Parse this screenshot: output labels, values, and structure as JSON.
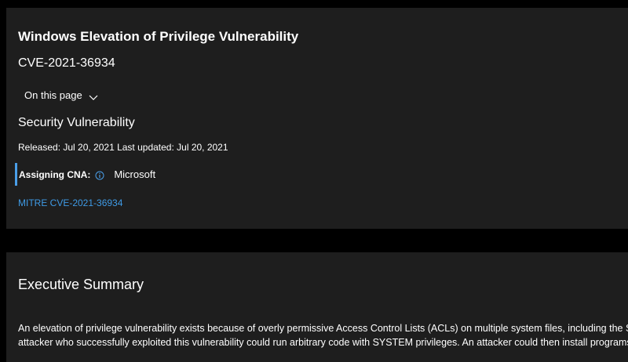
{
  "header": {
    "title": "Windows Elevation of Privilege Vulnerability",
    "cve_id": "CVE-2021-36934",
    "on_this_page": "On this page",
    "section_heading": "Security Vulnerability",
    "released": "Released: Jul 20, 2021 Last updated: Jul 20, 2021",
    "cna_label": "Assigning CNA:",
    "cna_value": "Microsoft",
    "mitre_link": "MITRE CVE-2021-36934"
  },
  "summary": {
    "heading": "Executive Summary",
    "line1": "An elevation of privilege vulnerability exists because of overly permissive Access Control Lists (ACLs) on multiple system files, including the Sec",
    "line2": "attacker who successfully exploited this vulnerability could run arbitrary code with SYSTEM privileges. An attacker could then install programs;"
  },
  "icons": {
    "chevron": "chevron-down-icon",
    "info": "info-icon"
  },
  "colors": {
    "background": "#000000",
    "card": "#1e1e1e",
    "link": "#3f9be6",
    "accent_bar": "#4a9ee8"
  }
}
